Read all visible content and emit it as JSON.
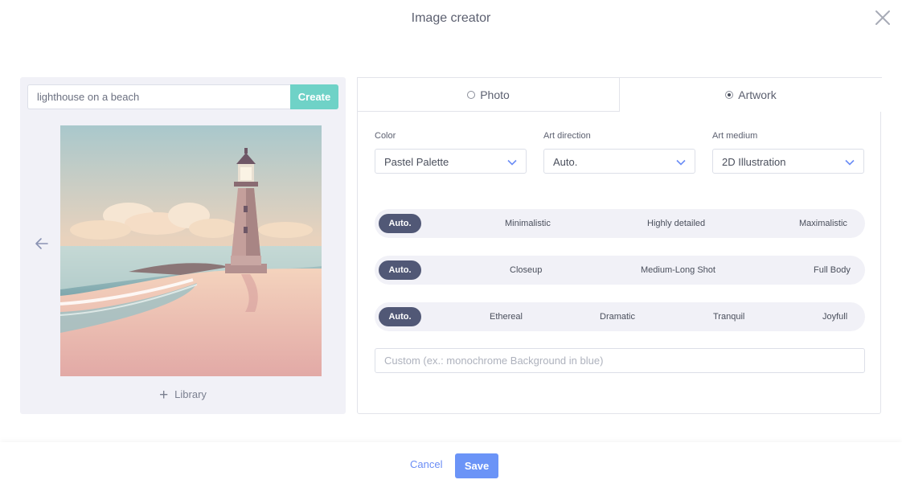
{
  "header": {
    "title": "Image creator"
  },
  "prompt": {
    "value": "lighthouse on a beach",
    "create_label": "Create"
  },
  "library_label": "Library",
  "tabs": [
    {
      "label": "Photo",
      "selected": false
    },
    {
      "label": "Artwork",
      "selected": true
    }
  ],
  "fields": {
    "color": {
      "label": "Color",
      "value": "Pastel Palette"
    },
    "art_direction": {
      "label": "Art direction",
      "value": "Auto."
    },
    "art_medium": {
      "label": "Art medium",
      "value": "2D Illustration"
    }
  },
  "detail_options": {
    "active": "Auto.",
    "options": [
      "Minimalistic",
      "Highly detailed",
      "Maximalistic"
    ]
  },
  "shot_options": {
    "active": "Auto.",
    "options": [
      "Closeup",
      "Medium-Long Shot",
      "Full Body"
    ]
  },
  "mood_options": {
    "active": "Auto.",
    "options": [
      "Ethereal",
      "Dramatic",
      "Tranquil",
      "Joyfull"
    ]
  },
  "custom": {
    "placeholder": "Custom (ex.: monochrome Background in blue)"
  },
  "footer": {
    "cancel_label": "Cancel",
    "save_label": "Save"
  },
  "colors": {
    "accent": "#6b94f7",
    "create": "#6fd2c7",
    "pill_active": "#515876"
  }
}
